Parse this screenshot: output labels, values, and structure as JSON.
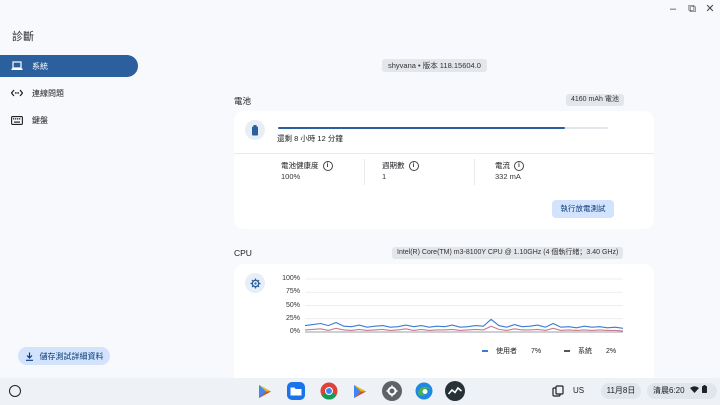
{
  "app": {
    "title": "診斷"
  },
  "window_controls": {
    "minimize": "–",
    "restore": "⧉",
    "close": "✕"
  },
  "sidebar": {
    "items": [
      {
        "label": "系統",
        "icon": "laptop-icon",
        "active": true
      },
      {
        "label": "連線問題",
        "icon": "connectivity-arrows-icon",
        "active": false
      },
      {
        "label": "鍵盤",
        "icon": "keyboard-icon",
        "active": false
      }
    ],
    "save_button": "儲存測試詳細資料"
  },
  "version_label": "shyvana • 版本 118.15604.0",
  "battery": {
    "title": "電池",
    "capacity": "4160 mAh 電池",
    "charge_fraction": 0.87,
    "remaining": "還剩 8 小時 12 分鐘",
    "stats": [
      {
        "label": "電池健康度",
        "value": "100%"
      },
      {
        "label": "週期數",
        "value": "1"
      },
      {
        "label": "電流",
        "value": "332 mA"
      }
    ],
    "run_button": "執行放電測試"
  },
  "cpu": {
    "title": "CPU",
    "model": "Intel(R) Core(TM) m3-8100Y CPU @ 1.10GHz (4 個執行緒；3.40 GHz)",
    "ytick_labels": [
      "100%",
      "75%",
      "50%",
      "25%",
      "0%"
    ],
    "legend": [
      {
        "name": "使用者",
        "value": "7%"
      },
      {
        "name": "系統",
        "value": "2%"
      }
    ]
  },
  "chart_data": {
    "type": "line",
    "ylim": [
      0,
      100
    ],
    "yticks": [
      "100%",
      "75%",
      "50%",
      "25%",
      "0%"
    ],
    "grid": true,
    "legend_position": "bottom-right",
    "series": [
      {
        "name": "使用者",
        "color": "#3a7bd5",
        "values": [
          12,
          14,
          16,
          12,
          18,
          11,
          10,
          13,
          9,
          11,
          12,
          9,
          10,
          13,
          10,
          12,
          9,
          11,
          10,
          13,
          9,
          10,
          12,
          11,
          24,
          12,
          9,
          14,
          10,
          11,
          13,
          9,
          16,
          9,
          10,
          8,
          11,
          9,
          10,
          8,
          9,
          7
        ]
      },
      {
        "name": "系統",
        "color": "#c77d8f",
        "values": [
          4,
          5,
          6,
          3,
          7,
          4,
          3,
          5,
          3,
          4,
          5,
          3,
          4,
          6,
          3,
          5,
          3,
          4,
          4,
          5,
          3,
          4,
          5,
          4,
          11,
          5,
          3,
          6,
          4,
          4,
          5,
          3,
          7,
          3,
          4,
          3,
          4,
          3,
          4,
          3,
          3,
          2
        ]
      }
    ]
  },
  "shelf": {
    "apps": [
      "play-store-icon",
      "files-icon",
      "chrome-icon",
      "play-store-icon",
      "settings-icon",
      "edge-icon",
      "diagnostics-icon"
    ],
    "input_method": "US",
    "date": "11月8日",
    "time": "清晨6:20"
  },
  "colors": {
    "accent": "#2b5f9e",
    "button_bg": "#d3e3fd",
    "user_line": "#3a7bd5",
    "system_line": "#c77d8f"
  }
}
